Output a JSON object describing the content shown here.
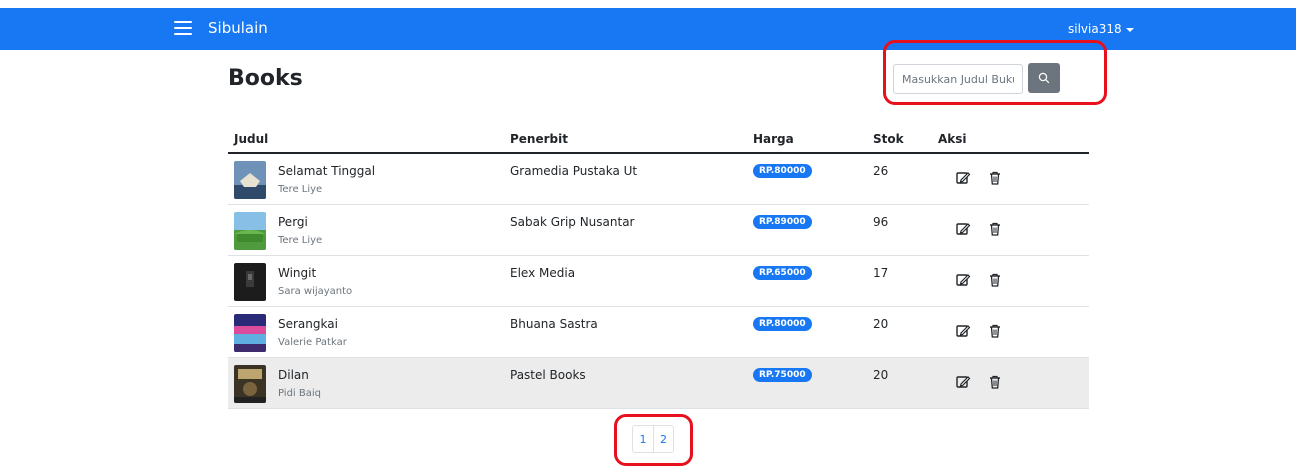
{
  "navbar": {
    "brand": "Sibulain",
    "username": "silvia318",
    "color": "#1877f2"
  },
  "page": {
    "title": "Books"
  },
  "search": {
    "placeholder": "Masukkan Judul Buku",
    "value": "",
    "button_icon": "search-icon"
  },
  "table": {
    "headers": [
      "Judul",
      "Penerbit",
      "Harga",
      "Stok",
      "Aksi"
    ],
    "rows": [
      {
        "title": "Selamat Tinggal",
        "author": "Tere Liye",
        "publisher": "Gramedia Pustaka Ut",
        "price": "RP.80000",
        "stock": "26"
      },
      {
        "title": "Pergi",
        "author": "Tere Liye",
        "publisher": "Sabak Grip Nusantar",
        "price": "RP.89000",
        "stock": "96"
      },
      {
        "title": "Wingit",
        "author": "Sara wijayanto",
        "publisher": "Elex Media",
        "price": "RP.65000",
        "stock": "17"
      },
      {
        "title": "Serangkai",
        "author": "Valerie Patkar",
        "publisher": "Bhuana Sastra",
        "price": "RP.80000",
        "stock": "20"
      },
      {
        "title": "Dilan",
        "author": "Pidi Baiq",
        "publisher": "Pastel Books",
        "price": "RP.75000",
        "stock": "20"
      }
    ],
    "action_icons": [
      "edit-icon",
      "trash-icon"
    ]
  },
  "pagination": {
    "pages": [
      "1",
      "2"
    ]
  },
  "annotation_color": "#e8101c"
}
